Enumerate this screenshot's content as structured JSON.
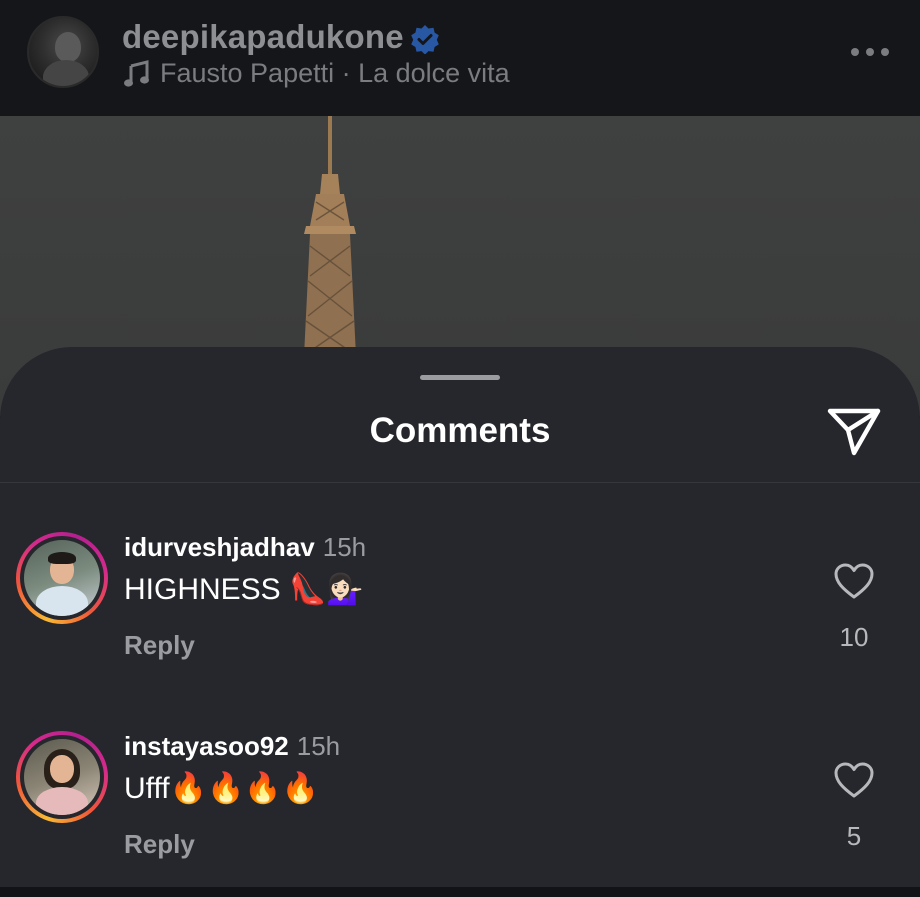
{
  "post": {
    "username": "deepikapadukone",
    "verified": true,
    "music": "Fausto Papetti · La dolce vita"
  },
  "sheet": {
    "title": "Comments"
  },
  "comments": [
    {
      "username": "idurveshjadhav",
      "time": "15h",
      "text": "HIGHNESS 👠💁🏻‍♀️",
      "reply_label": "Reply",
      "likes": "10"
    },
    {
      "username": "instayasoo92",
      "time": "15h",
      "text": "Ufff🔥🔥🔥🔥",
      "reply_label": "Reply",
      "likes": "5"
    }
  ],
  "icons": {
    "verified": "verified-badge-icon",
    "music": "music-note-icon",
    "more": "more-options-icon",
    "share": "share-send-icon",
    "like": "heart-icon"
  },
  "colors": {
    "background": "#121317",
    "sheet": "#25272c",
    "verified": "#2f6dd1",
    "secondary_text": "#9a9ca1",
    "story_ring_start": "#f9b934",
    "story_ring_end": "#d42a8c"
  }
}
